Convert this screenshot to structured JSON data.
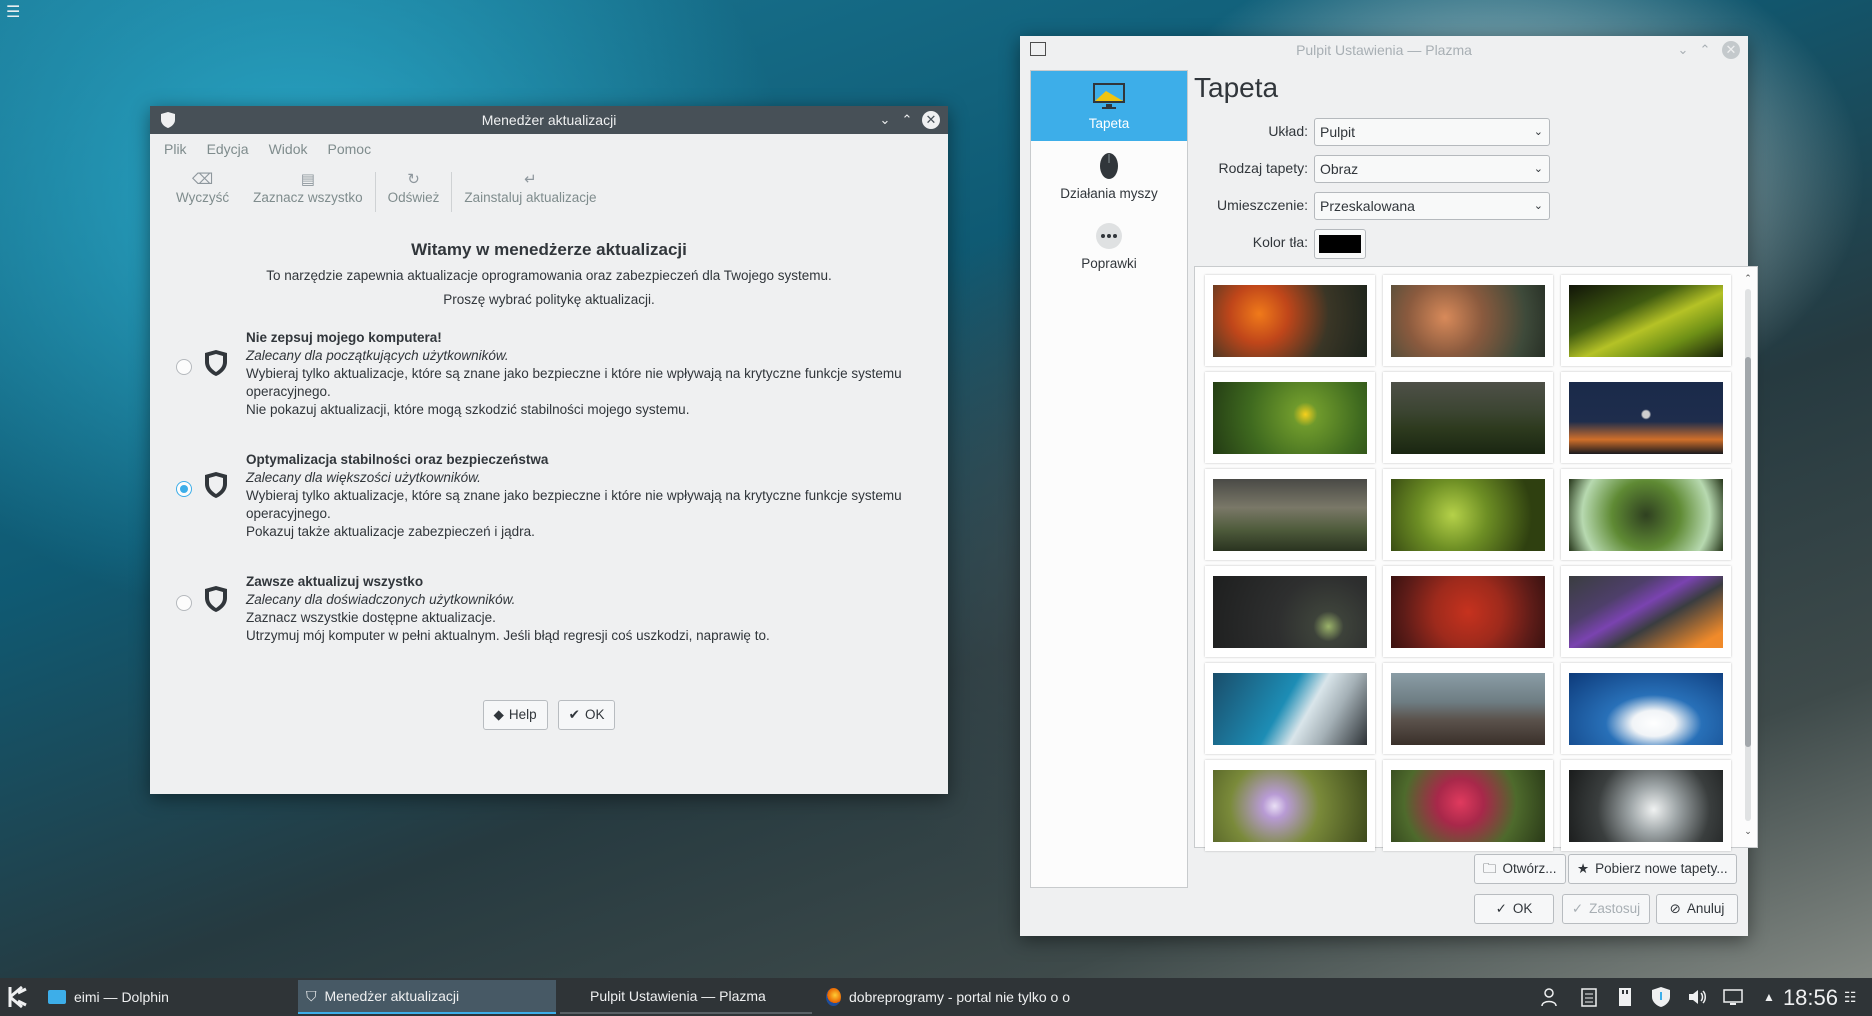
{
  "desktop": {
    "menu_icon": "hamburger-icon"
  },
  "update_manager": {
    "title": "Menedżer aktualizacji",
    "menu": [
      "Plik",
      "Edycja",
      "Widok",
      "Pomoc"
    ],
    "toolbar": [
      {
        "label": "Wyczyść",
        "icon": "clear-icon"
      },
      {
        "label": "Zaznacz wszystko",
        "icon": "select-all-icon"
      },
      {
        "label": "Odśwież",
        "icon": "refresh-icon"
      },
      {
        "label": "Zainstaluj aktualizacje",
        "icon": "install-icon"
      }
    ],
    "welcome_title": "Witamy w menedżerze aktualizacji",
    "intro_line1": "To narzędzie zapewnia aktualizacje oprogramowania oraz zabezpieczeń dla Twojego systemu.",
    "intro_line2": "Proszę wybrać politykę aktualizacji.",
    "policies": [
      {
        "title": "Nie zepsuj mojego komputera!",
        "subtitle": "Zalecany dla początkujących użytkowników.",
        "desc1": "Wybieraj tylko aktualizacje, które są znane jako bezpieczne i które nie wpływają na krytyczne funkcje systemu",
        "desc2": "operacyjnego.",
        "desc3": "Nie pokazuj aktualizacji, które mogą szkodzić stabilności mojego systemu.",
        "selected": false
      },
      {
        "title": "Optymalizacja stabilności oraz bezpieczeństwa",
        "subtitle": "Zalecany dla większości użytkowników.",
        "desc1": "Wybieraj tylko aktualizacje, które są znane jako bezpieczne i które nie wpływają na krytyczne funkcje systemu",
        "desc2": "operacyjnego.",
        "desc3": "Pokazuj także aktualizacje zabezpieczeń i jądra.",
        "selected": true
      },
      {
        "title": "Zawsze aktualizuj wszystko",
        "subtitle": "Zalecany dla doświadczonych użytkowników.",
        "desc1": "Zaznacz wszystkie dostępne aktualizacje.",
        "desc2": "",
        "desc3": "Utrzymuj mój komputer w pełni aktualnym. Jeśli błąd regresji coś uszkodzi, naprawię to.",
        "selected": false
      }
    ],
    "help_label": "Help",
    "ok_label": "OK"
  },
  "plasma_settings": {
    "title": "Pulpit Ustawienia  — Plazma",
    "sidebar": [
      {
        "label": "Tapeta",
        "icon": "wallpaper-icon",
        "active": true
      },
      {
        "label": "Działania myszy",
        "icon": "mouse-icon",
        "active": false
      },
      {
        "label": "Poprawki",
        "icon": "tweaks-icon",
        "active": false
      }
    ],
    "page_title": "Tapeta",
    "layout_label": "Układ:",
    "layout_value": "Pulpit",
    "wallpaper_type_label": "Rodzaj tapety:",
    "wallpaper_type_value": "Obraz",
    "positioning_label": "Umieszczenie:",
    "positioning_value": "Przeskalowana",
    "bg_color_label": "Kolor tła:",
    "bg_color": "#000000",
    "thumbnails": [
      "dandelion-orange",
      "autumn-leaves",
      "green-leaf",
      "yellow-flower",
      "grass-field",
      "moon-dusk",
      "blurred-meadow",
      "green-foliage",
      "tree-canopy",
      "mint-logo-dark",
      "red-maple",
      "purple-abstract",
      "blue-curve",
      "pebble-shore",
      "blue-sky-clouds",
      "purple-flowers",
      "red-tulips",
      "waterfall"
    ],
    "open_label": "Otwórz...",
    "get_new_label": "Pobierz nowe tapety...",
    "ok_label": "OK",
    "apply_label": "Zastosuj",
    "cancel_label": "Anuluj"
  },
  "taskbar": {
    "tasks": [
      {
        "label": "eimi — Dolphin",
        "icon": "dolphin-icon",
        "active": false
      },
      {
        "label": "Menedżer aktualizacji",
        "icon": "shield-icon",
        "active": true
      },
      {
        "label": "Pulpit Ustawienia  — Plazma",
        "icon": "",
        "active": false
      },
      {
        "label": "dobreprogramy - portal nie tylko o o",
        "icon": "firefox-icon",
        "active": false
      }
    ],
    "tray_icons": [
      "user-switch-icon",
      "clipboard-icon",
      "sd-card-icon",
      "update-shield-icon",
      "volume-icon",
      "network-icon",
      "expand-tray-icon"
    ],
    "clock": "18:56"
  }
}
